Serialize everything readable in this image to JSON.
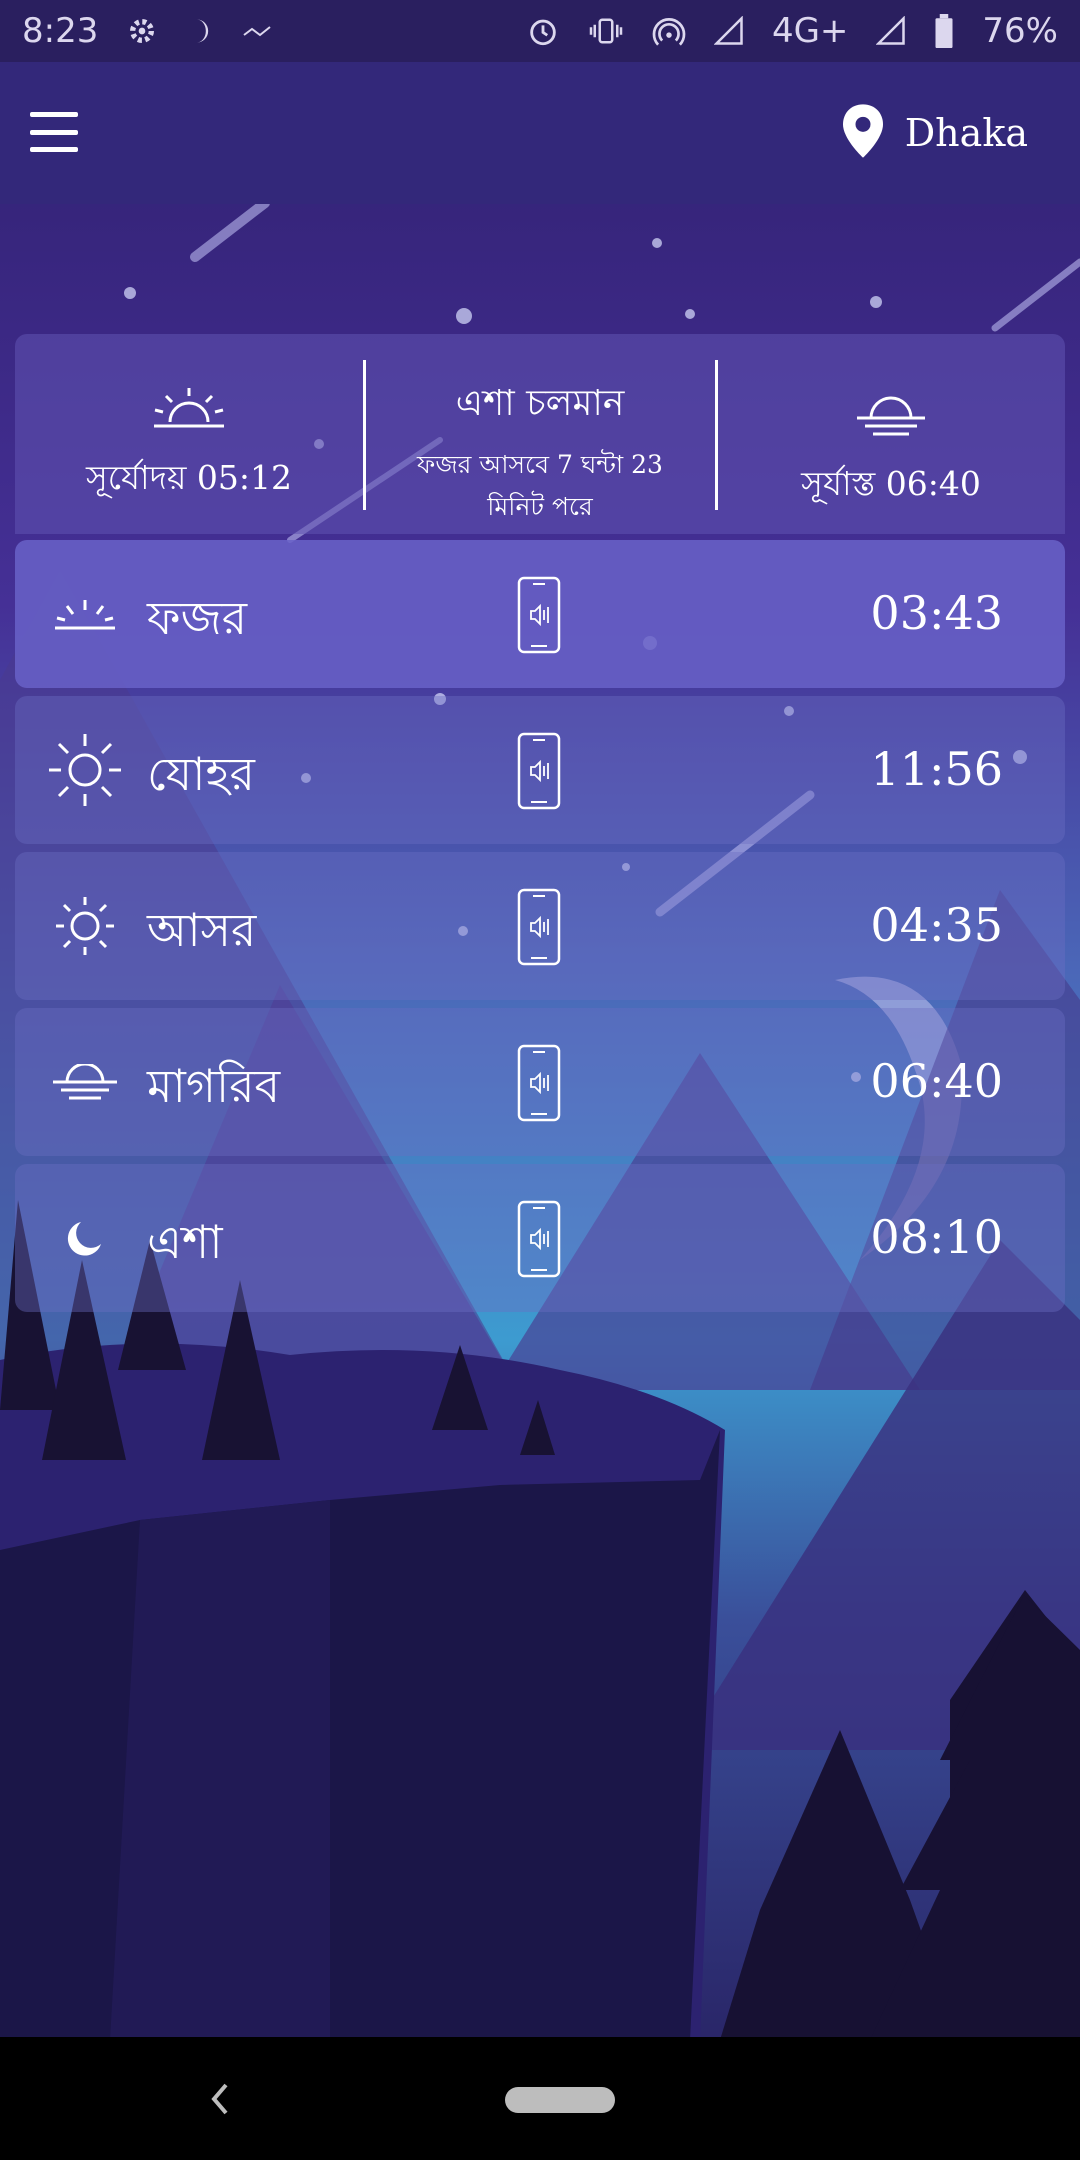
{
  "status_bar": {
    "time": "8:23",
    "network_label": "4G+",
    "battery_text": "76%",
    "icons": [
      "gear-icon",
      "moon-icon",
      "signal-small-icon",
      "alarm-icon",
      "vibrate-icon",
      "hotspot-icon",
      "signal-icon",
      "battery-icon"
    ]
  },
  "header": {
    "menu_icon": "hamburger-menu-icon",
    "location": "Dhaka",
    "location_icon": "map-pin-icon"
  },
  "summary": {
    "sunrise_label": "সূর্যোদয় 05:12",
    "sunset_label": "সূর্যাস্ত 06:40",
    "current_status": "এশা চলমান",
    "next_prayer_text": "ফজর আসবে 7 ঘন্টা 23 মিনিট পরে"
  },
  "prayers": [
    {
      "name": "ফজর",
      "time": "03:43",
      "icon": "sunrise-icon",
      "alert_icon": "phone-sound-icon"
    },
    {
      "name": "যোহর",
      "time": "11:56",
      "icon": "sun-icon",
      "alert_icon": "phone-sound-icon"
    },
    {
      "name": "আসর",
      "time": "04:35",
      "icon": "small-sun-icon",
      "alert_icon": "phone-sound-icon"
    },
    {
      "name": "মাগরিব",
      "time": "06:40",
      "icon": "sunset-icon",
      "alert_icon": "phone-sound-icon"
    },
    {
      "name": "এশা",
      "time": "08:10",
      "icon": "moon-icon",
      "alert_icon": "phone-sound-icon"
    }
  ],
  "nav": {
    "back_icon": "back-chevron-icon",
    "home_icon": "home-pill-icon"
  },
  "colors": {
    "app_bar": "#33287a",
    "status_bar": "#2a1f5f",
    "active_row": "#6862c8",
    "row": "#6c6ec4",
    "sky_top": "#2f1f6e",
    "sky_bottom": "#3d9bd0",
    "mountain": "#4a3a8e",
    "cliff": "#1b1648"
  }
}
